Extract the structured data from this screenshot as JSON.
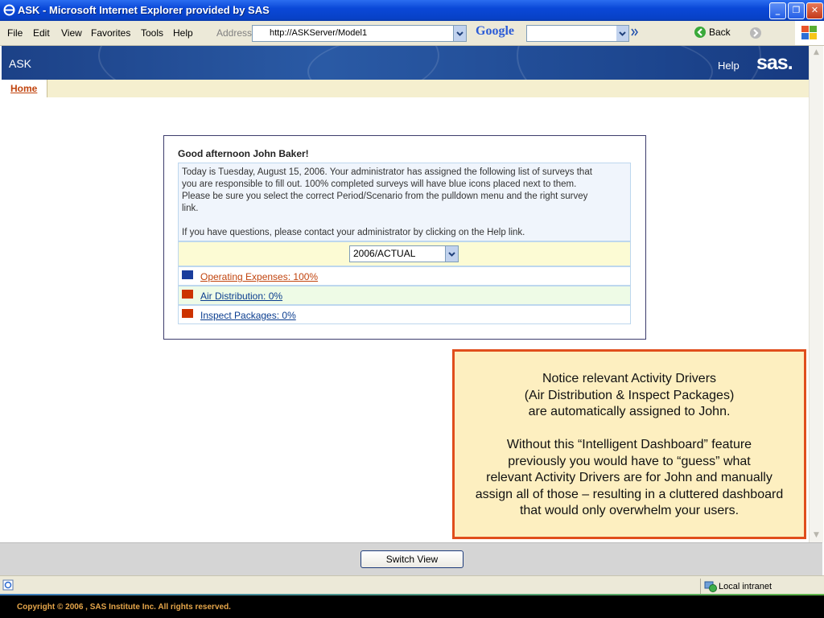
{
  "window": {
    "title": "ASK - Microsoft Internet Explorer provided by SAS"
  },
  "menubar": {
    "items": [
      "File",
      "Edit",
      "View",
      "Favorites",
      "Tools",
      "Help"
    ],
    "address_label": "Address",
    "address_value": "http://ASKServer/Model1",
    "search_brand": "Google",
    "back_label": "Back"
  },
  "banner": {
    "app_name": "ASK",
    "help": "Help",
    "logo": "sas."
  },
  "tabs": {
    "home": "Home"
  },
  "card": {
    "greeting": "Good afternoon John Baker!",
    "message_lines": [
      "Today is Tuesday, August 15, 2006. Your administrator has assigned the following list of surveys that",
      "you are responsible to fill out. 100% completed surveys will have blue icons placed next to them.",
      "Please be sure you select the correct Period/Scenario from the pulldown menu and the right survey",
      "link."
    ],
    "help_line": "If you have questions, please contact your administrator by clicking on the Help link.",
    "period": "2006/ACTUAL",
    "surveys": [
      {
        "label": "Operating Expenses: 100%",
        "icon_color": "#1a3d9c",
        "link_color": "#c1440e",
        "row_bg": "#ffffff"
      },
      {
        "label": "Air Distribution: 0%",
        "icon_color": "#cc3300",
        "link_color": "#0a3d8f",
        "row_bg": "#eefbe6"
      },
      {
        "label": "Inspect Packages: 0%",
        "icon_color": "#cc3300",
        "link_color": "#0a3d8f",
        "row_bg": "#ffffff"
      }
    ]
  },
  "callout": {
    "para1": [
      "Notice relevant Activity Drivers",
      "(Air Distribution & Inspect Packages)",
      "are automatically assigned to John."
    ],
    "para2": [
      "Without this “Intelligent Dashboard” feature",
      "previously you would have to “guess” what",
      "relevant Activity Drivers are for John and manually",
      "assign all of those – resulting in a cluttered dashboard",
      "that would only overwhelm your users."
    ]
  },
  "footer": {
    "switch_view": "Switch View"
  },
  "status": {
    "zone": "Local intranet"
  },
  "copyright": "Copyright © 2006 , SAS Institute Inc. All rights reserved."
}
